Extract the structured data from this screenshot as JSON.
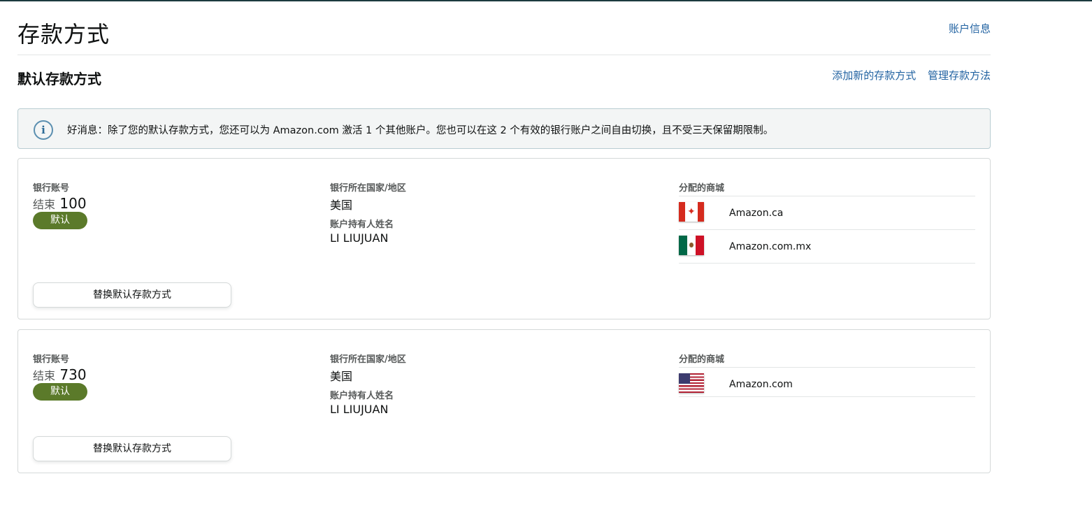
{
  "page": {
    "title": "存款方式",
    "account_link": "账户信息"
  },
  "section": {
    "title": "默认存款方式",
    "add_link": "添加新的存款方式",
    "manage_link": "管理存款方法"
  },
  "info": {
    "icon": "info-icon",
    "text": "好消息：除了您的默认存款方式，您还可以为 Amazon.com 激活 1 个其他账户。您也可以在这 2 个有效的银行账户之间自由切换，且不受三天保留期限制。"
  },
  "labels": {
    "bank_account": "银行账号",
    "bank_country": "银行所在国家/地区",
    "holder_name": "账户持有人姓名",
    "marketplaces": "分配的商城",
    "ending_prefix": "结束",
    "default_badge": "默认",
    "replace_button": "替换默认存款方式"
  },
  "accounts": [
    {
      "ending": "100",
      "country": "美国",
      "holder": "LI LIUJUAN",
      "marketplaces": [
        {
          "name": "Amazon.ca",
          "flag": "canada-flag-icon"
        },
        {
          "name": "Amazon.com.mx",
          "flag": "mexico-flag-icon"
        }
      ]
    },
    {
      "ending": "730",
      "country": "美国",
      "holder": "LI LIUJUAN",
      "marketplaces": [
        {
          "name": "Amazon.com",
          "flag": "usa-flag-icon"
        }
      ]
    }
  ],
  "colors": {
    "link": "#2162a1",
    "badge": "#5b7a2a",
    "info_bg": "#f3f5f5",
    "info_border": "#b9cdd2"
  }
}
